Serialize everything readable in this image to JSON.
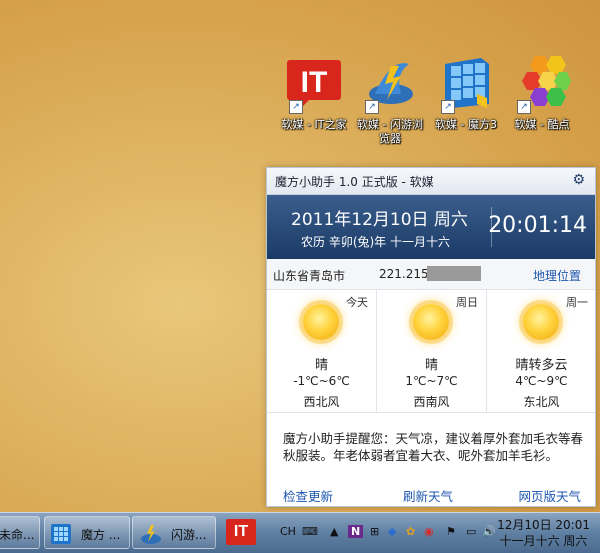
{
  "desktop_icons": [
    {
      "label": "软媒 - IT之家"
    },
    {
      "label": "软媒 - 闪游浏览器"
    },
    {
      "label": "软媒 - 魔方3"
    },
    {
      "label": "软媒 - 酷点"
    }
  ],
  "gadget": {
    "title": "魔方小助手 1.0 正式版 - 软媒",
    "date_line": "2011年12月10日 周六",
    "lunar_line": "农历   辛卯(兔)年   十一月十六",
    "time": "20:01:14",
    "city": "山东省青岛市",
    "ip": "221.215",
    "geo_link": "地理位置",
    "forecast": [
      {
        "weekday": "今天",
        "condition": "晴",
        "temp": "-1℃~6℃",
        "wind": "西北风"
      },
      {
        "weekday": "周日",
        "condition": "晴",
        "temp": "1℃~7℃",
        "wind": "西南风"
      },
      {
        "weekday": "周一",
        "condition": "晴转多云",
        "temp": "4℃~9℃",
        "wind": "东北风"
      }
    ],
    "tip": "魔方小助手提醒您：天气凉，建议着厚外套加毛衣等春秋服装。年老体弱者宜着大衣、呢外套加羊毛衫。",
    "links": {
      "check_update": "检查更新",
      "refresh": "刷新天气",
      "web": "网页版天气"
    }
  },
  "taskbar": {
    "buttons": [
      {
        "label": "未命..."
      },
      {
        "label": "魔方 ..."
      },
      {
        "label": "闪游..."
      }
    ],
    "ime": "CH",
    "clock_time": "12月10日 20:01",
    "clock_date": "十一月十六 周六"
  }
}
